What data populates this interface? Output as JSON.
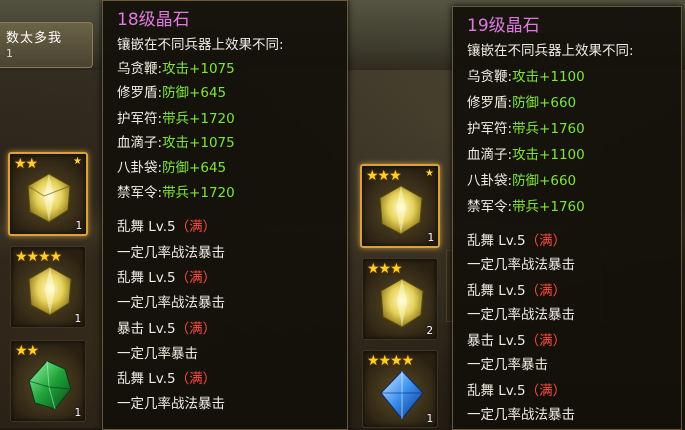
{
  "header": {
    "name": "数太多我",
    "sub": "1"
  },
  "left_slots": [
    {
      "stars": "★★",
      "count": "1",
      "type": "yellow",
      "selected": true
    },
    {
      "stars": "★★★★",
      "count": "1",
      "type": "yellow",
      "selected": false
    },
    {
      "stars": "★★",
      "count": "1",
      "type": "green",
      "selected": false
    }
  ],
  "mid_slots": [
    {
      "stars": "★★★",
      "count": "1",
      "type": "yellow",
      "selected": true
    },
    {
      "stars": "★★★",
      "count": "2",
      "type": "yellow",
      "selected": false
    },
    {
      "stars": "★★★★",
      "count": "1",
      "type": "blue",
      "selected": false
    }
  ],
  "tooltip_left": {
    "title": "18级晶石",
    "intro": "镶嵌在不同兵器上效果不同:",
    "effects": [
      {
        "item": "乌贪鞭:",
        "stat": "攻击+1075"
      },
      {
        "item": "修罗盾:",
        "stat": "防御+645"
      },
      {
        "item": "护军符:",
        "stat": "带兵+1720"
      },
      {
        "item": "血滴子:",
        "stat": "攻击+1075"
      },
      {
        "item": "八卦袋:",
        "stat": "防御+645"
      },
      {
        "item": "禁军令:",
        "stat": "带兵+1720"
      }
    ],
    "skills": [
      {
        "name": "乱舞 Lv.5",
        "tag": "（满）",
        "desc": "一定几率战法暴击"
      },
      {
        "name": "乱舞 Lv.5",
        "tag": "（满）",
        "desc": "一定几率战法暴击"
      },
      {
        "name": "暴击 Lv.5",
        "tag": "（满）",
        "desc": "一定几率暴击"
      },
      {
        "name": "乱舞 Lv.5",
        "tag": "（满）",
        "desc": "一定几率战法暴击"
      }
    ]
  },
  "tooltip_right": {
    "title": "19级晶石",
    "intro": "镶嵌在不同兵器上效果不同:",
    "effects": [
      {
        "item": "乌贪鞭:",
        "stat": "攻击+1100"
      },
      {
        "item": "修罗盾:",
        "stat": "防御+660"
      },
      {
        "item": "护军符:",
        "stat": "带兵+1760"
      },
      {
        "item": "血滴子:",
        "stat": "攻击+1100"
      },
      {
        "item": "八卦袋:",
        "stat": "防御+660"
      },
      {
        "item": "禁军令:",
        "stat": "带兵+1760"
      }
    ],
    "skills": [
      {
        "name": "乱舞 Lv.5",
        "tag": "（满）",
        "desc": "一定几率战法暴击"
      },
      {
        "name": "乱舞 Lv.5",
        "tag": "（满）",
        "desc": "一定几率战法暴击"
      },
      {
        "name": "暴击 Lv.5",
        "tag": "（满）",
        "desc": "一定几率暴击"
      },
      {
        "name": "乱舞 Lv.5",
        "tag": "（满）",
        "desc": "一定几率战法暴击"
      }
    ]
  },
  "colors": {
    "title": "#e07ae0",
    "stat": "#7ee53a",
    "max_tag": "#ff4a3a",
    "selected_border": "#d9a23c"
  }
}
